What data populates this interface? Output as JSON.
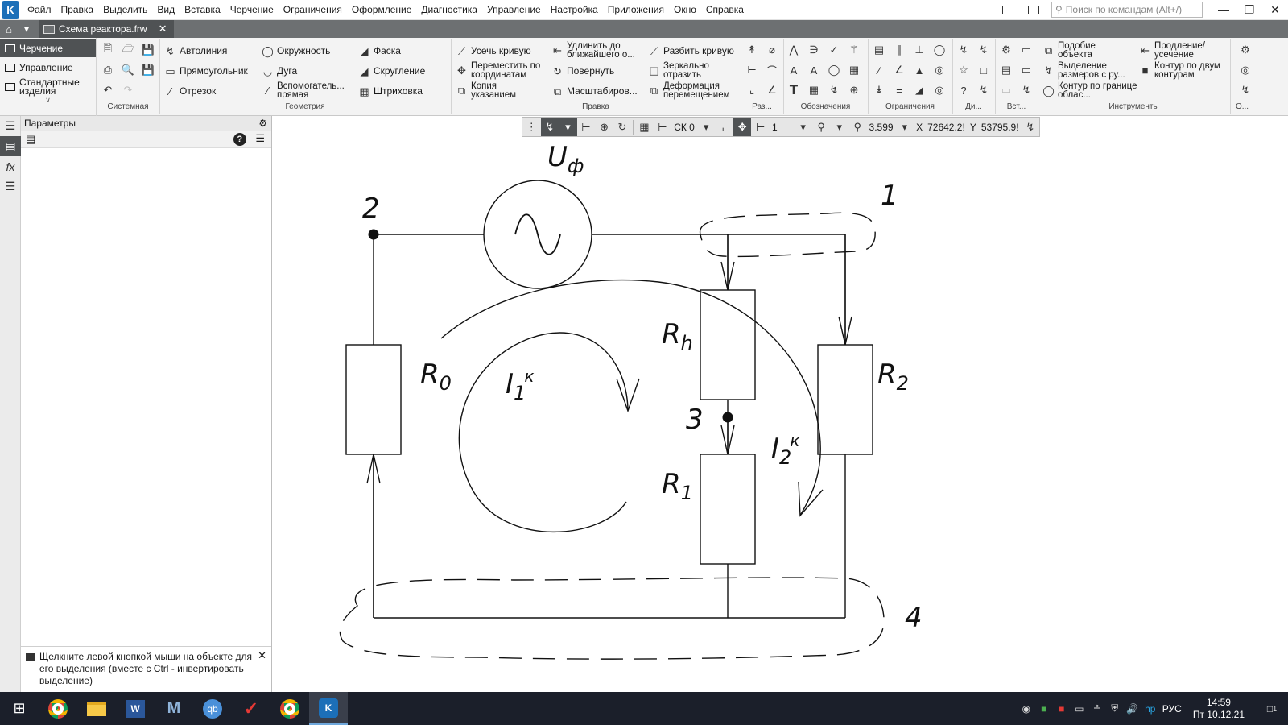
{
  "menu": [
    "Файл",
    "Правка",
    "Выделить",
    "Вид",
    "Вставка",
    "Черчение",
    "Ограничения",
    "Оформление",
    "Диагностика",
    "Управление",
    "Настройка",
    "Приложения",
    "Окно",
    "Справка"
  ],
  "search": {
    "placeholder": "Поиск по командам (Alt+/)"
  },
  "doc_tab": {
    "title": "Схема реактора.frw"
  },
  "modes": [
    "Черчение",
    "Управление",
    "Стандартные изделия"
  ],
  "ribbon": {
    "geometry": [
      "Автолиния",
      "Окружность",
      "Фаска",
      "Прямоугольник",
      "Дуга",
      "Скругление",
      "Отрезок",
      "Вспомогатель... прямая",
      "Штриховка"
    ],
    "edit": [
      "Усечь кривую",
      "Удлинить до ближайшего о...",
      "Разбить кривую",
      "Переместить по координатам",
      "Повернуть",
      "Зеркально отразить",
      "Копия указанием",
      "Масштабиров...",
      "Деформация перемещением"
    ],
    "tools": [
      "Подобие объекта",
      "Продление/ усечение",
      "Выделение размеров с ру...",
      "Контур по двум контурам",
      "Контур по границе облас..."
    ],
    "groups": [
      "Системная",
      "Геометрия",
      "Правка",
      "Раз...",
      "Обозначения",
      "Ограничения",
      "Ди...",
      "Вст...",
      "Инструменты",
      "О..."
    ]
  },
  "panel": {
    "title": "Параметры",
    "hint": "Щелкните левой кнопкой мыши на объекте для его выделения (вместе с Ctrl - инвертировать выделение)"
  },
  "float_toolbar": {
    "cs": "СК 0",
    "layer": "1",
    "zoom": "3.599",
    "x_label": "X",
    "x_value": "72642.2!",
    "y_label": "Y",
    "y_value": "53795.9!"
  },
  "drawing": {
    "source": {
      "main": "U",
      "sub": "ф"
    },
    "r0": {
      "main": "R",
      "sub": "0"
    },
    "rh": {
      "main": "R",
      "sub": "h"
    },
    "r1": {
      "main": "R",
      "sub": "1"
    },
    "r2": {
      "main": "R",
      "sub": "2"
    },
    "i1": {
      "main": "I",
      "sub": "1",
      "sup": "к"
    },
    "i2": {
      "main": "I",
      "sub": "2",
      "sup": "к"
    },
    "nodes": [
      "1",
      "2",
      "3",
      "4"
    ]
  },
  "taskbar": {
    "lang": "РУС",
    "time": "14:59",
    "date": "Пт 10.12.21",
    "notif": "1"
  },
  "colors": {
    "accent": "#1c6fb8",
    "dark_tab": "#4f5254",
    "taskbar": "#1b1f2a"
  }
}
